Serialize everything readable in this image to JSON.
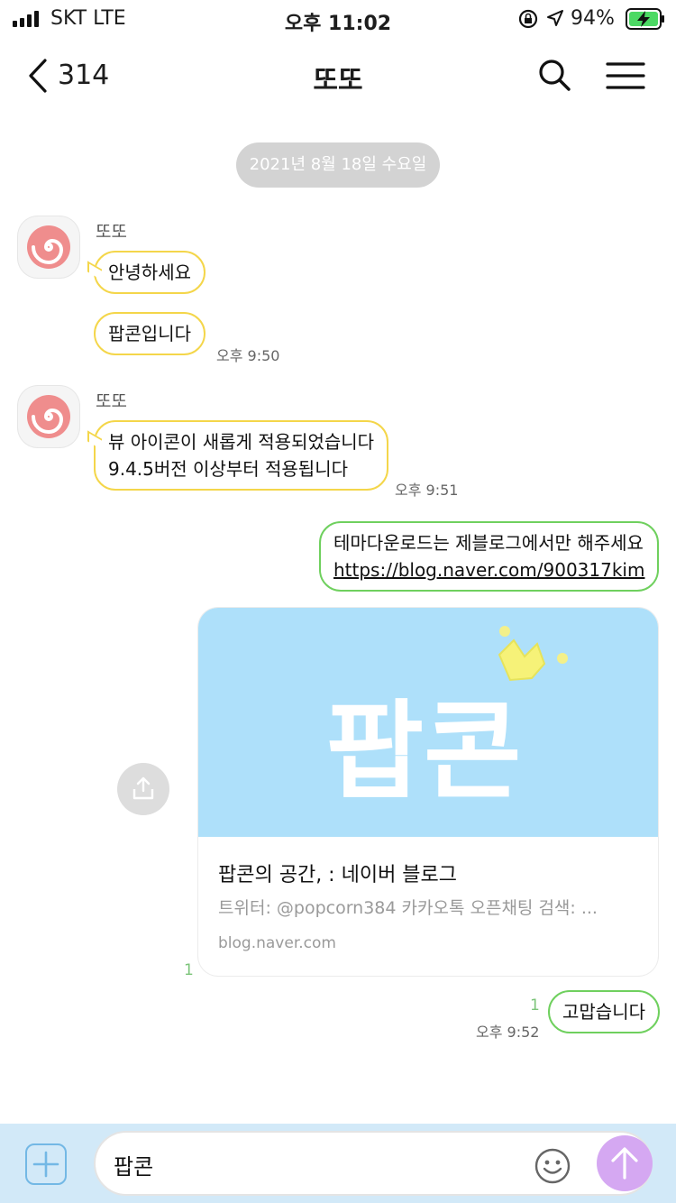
{
  "status_bar": {
    "carrier": "SKT   LTE",
    "clock": "오후 11:02",
    "battery_pct": "94%"
  },
  "header": {
    "back_count": "314",
    "title": "또또"
  },
  "date_pill": "2021년 8월 18일 수요일",
  "messages": {
    "group1": {
      "sender": "또또",
      "bubble1": "안녕하세요",
      "bubble2": "팝콘입니다",
      "time": "오후 9:50"
    },
    "group2": {
      "sender": "또또",
      "line1": "뷰 아이콘이 새롭게 적용되었습니다",
      "line2": "9.4.5버전 이상부터 적용됩니다",
      "time": "오후 9:51"
    },
    "mine1": {
      "line1": "테마다운로드는 제블로그에서만 해주세요",
      "link": "https://blog.naver.com/900317kim"
    },
    "card": {
      "thumb_text": "팝콘",
      "title": "팝콘의 공간, : 네이버 블로그",
      "desc": "트위터: @popcorn384 카카오톡 오픈채팅 검색: ...",
      "domain": "blog.naver.com",
      "unread": "1"
    },
    "mine2": {
      "text": "고맙습니다",
      "unread": "1",
      "time": "오후 9:52"
    }
  },
  "input": {
    "value": "팝콘"
  },
  "colors": {
    "received_border": "#f4d64a",
    "sent_border": "#6fd05e",
    "input_bar_bg": "#d2e9f8",
    "send_button": "#d5a8f2",
    "card_thumb_bg": "#aee0fa"
  }
}
